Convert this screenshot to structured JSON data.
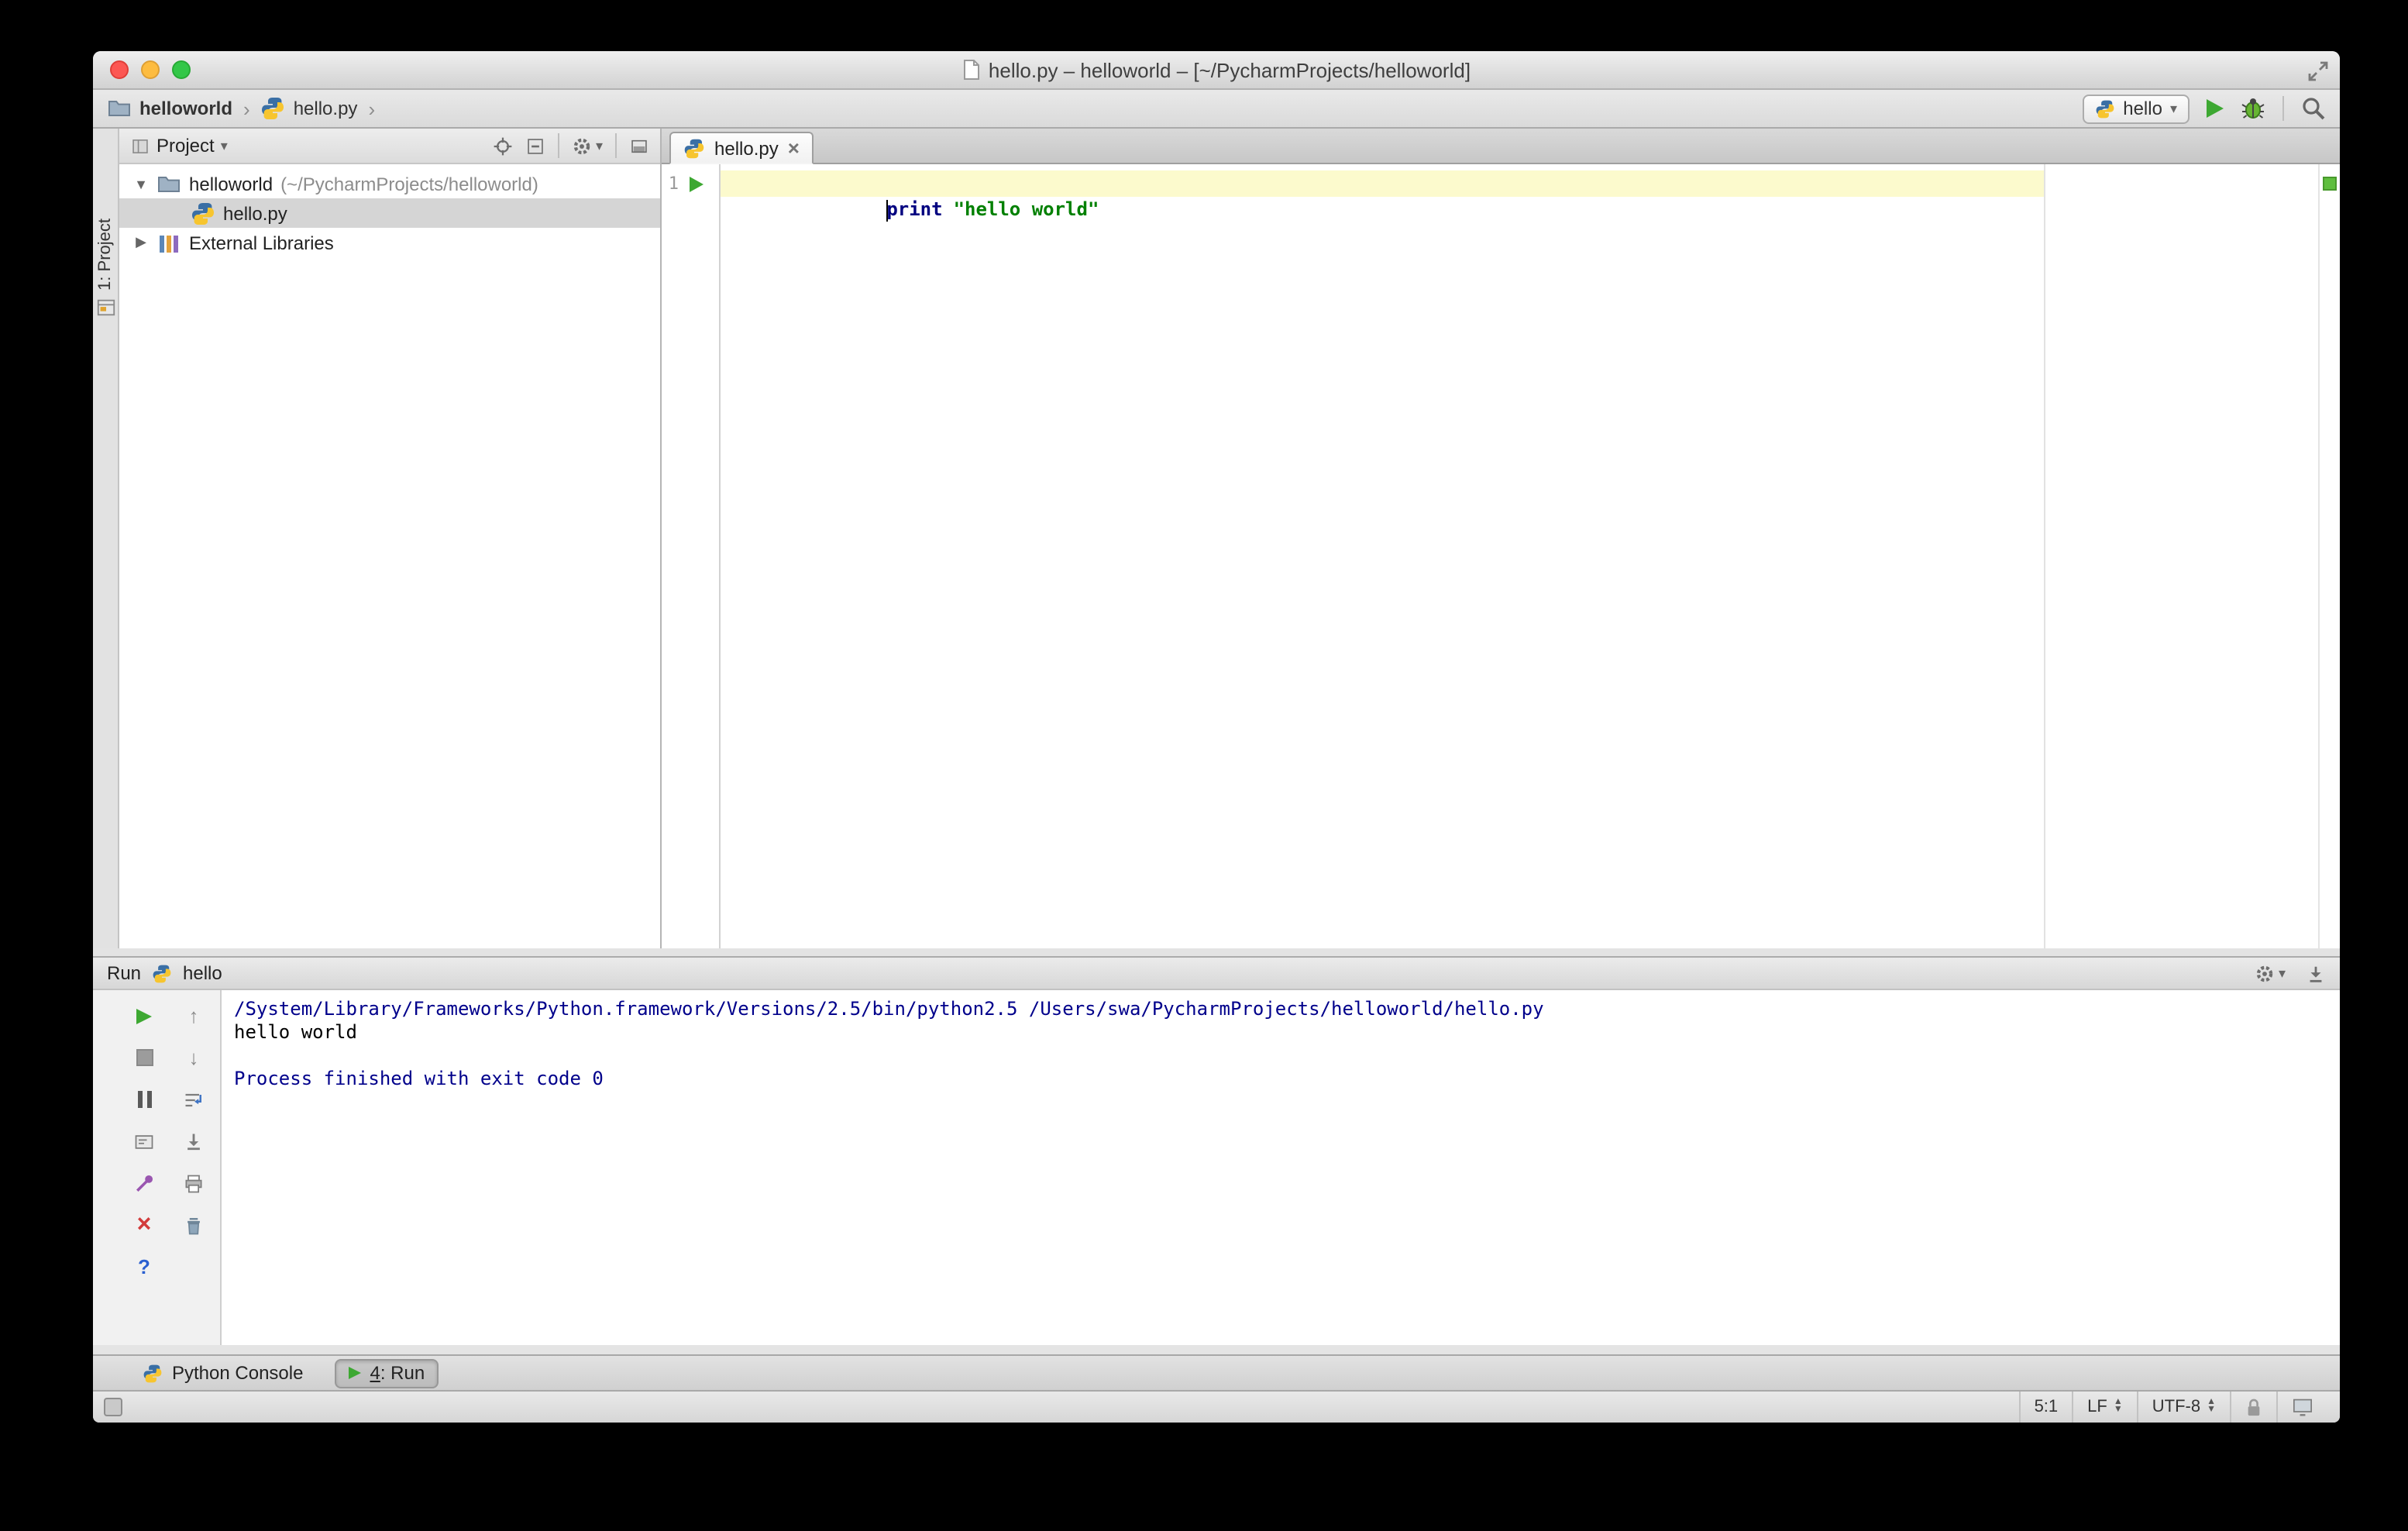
{
  "colors": {
    "keyword": "#000080",
    "string": "#008000",
    "console-info": "#00008b",
    "console-text": "#000000",
    "current-line": "#fcfacd",
    "selection": "#d5d5d5",
    "run-green": "#3da832",
    "ok-green": "#5fbe3e"
  },
  "window": {
    "title": "hello.py – helloworld – [~/PycharmProjects/helloworld]"
  },
  "navbar": {
    "crumb1": "helloworld",
    "crumb2": "hello.py",
    "run_config": "hello"
  },
  "stripe": {
    "project": "1: Project"
  },
  "project": {
    "header": "Project",
    "root_name": "helloworld",
    "root_path": "(~/PycharmProjects/helloworld)",
    "file": "hello.py",
    "external": "External Libraries"
  },
  "editor": {
    "tab": "hello.py",
    "line1_number": "1",
    "keyword": "print",
    "string_literal": "\"hello world\""
  },
  "run": {
    "title": "Run",
    "config": "hello",
    "line_cmd": "/System/Library/Frameworks/Python.framework/Versions/2.5/bin/python2.5 /Users/swa/PycharmProjects/helloworld/hello.py",
    "line_out": "hello world",
    "line_blank": "",
    "line_exit": "Process finished with exit code 0"
  },
  "bottom": {
    "python_console": "Python Console",
    "run_tab_number": "4",
    "run_tab_rest": ": Run"
  },
  "status": {
    "caret": "5:1",
    "line_sep": "LF",
    "encoding": "UTF-8"
  },
  "icons": {
    "chevron": "›",
    "dropdown": "▾",
    "tree_open": "▼",
    "tree_closed": "▶",
    "close_tab": "×",
    "close_panel": "×",
    "help": "?",
    "up_arrow": "↑",
    "down_arrow": "↓",
    "tri_up": "▲",
    "tri_down": "▼"
  }
}
